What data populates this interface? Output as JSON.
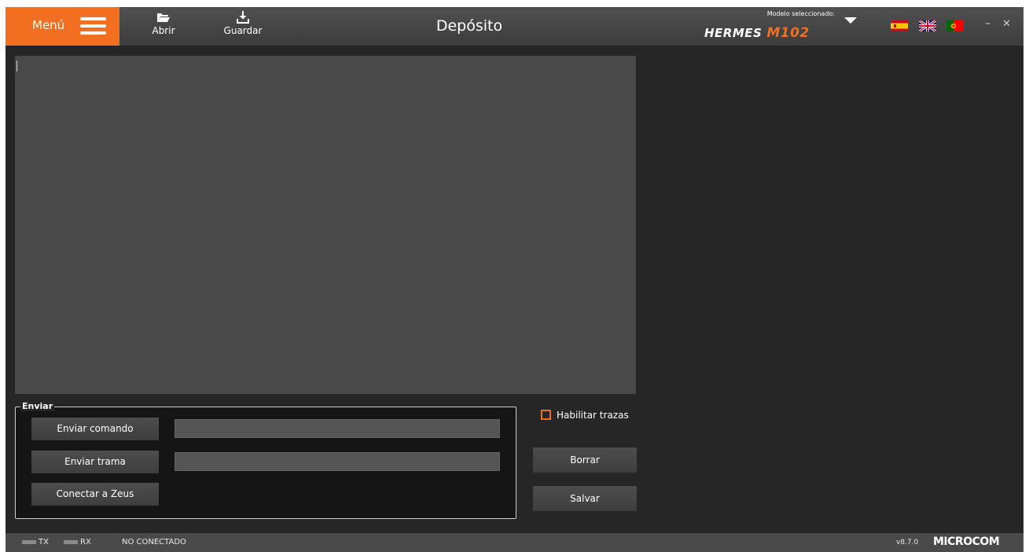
{
  "header": {
    "menu_label": "Menú",
    "open_label": "Abrir",
    "save_label": "Guardar",
    "title": "Depósito",
    "model_caption": "Modelo seleccionado:",
    "model_brand": "HERMES",
    "model_code": "M102",
    "languages": [
      "es",
      "en",
      "pt"
    ]
  },
  "send_group": {
    "legend": "Enviar",
    "send_command_label": "Enviar comando",
    "send_frame_label": "Enviar trama",
    "connect_zeus_label": "Conectar a Zeus",
    "command_value": "",
    "frame_value": ""
  },
  "controls": {
    "enable_traces_label": "Habilitar trazas",
    "enable_traces_checked": false,
    "clear_label": "Borrar",
    "save_label": "Salvar"
  },
  "statusbar": {
    "tx_label": "TX",
    "rx_label": "RX",
    "connection_status": "NO CONECTADO",
    "version": "v8.7.0",
    "brand": "MICROCOM"
  },
  "colors": {
    "accent": "#f26f21",
    "background": "#262626",
    "trace_background": "#494949"
  }
}
